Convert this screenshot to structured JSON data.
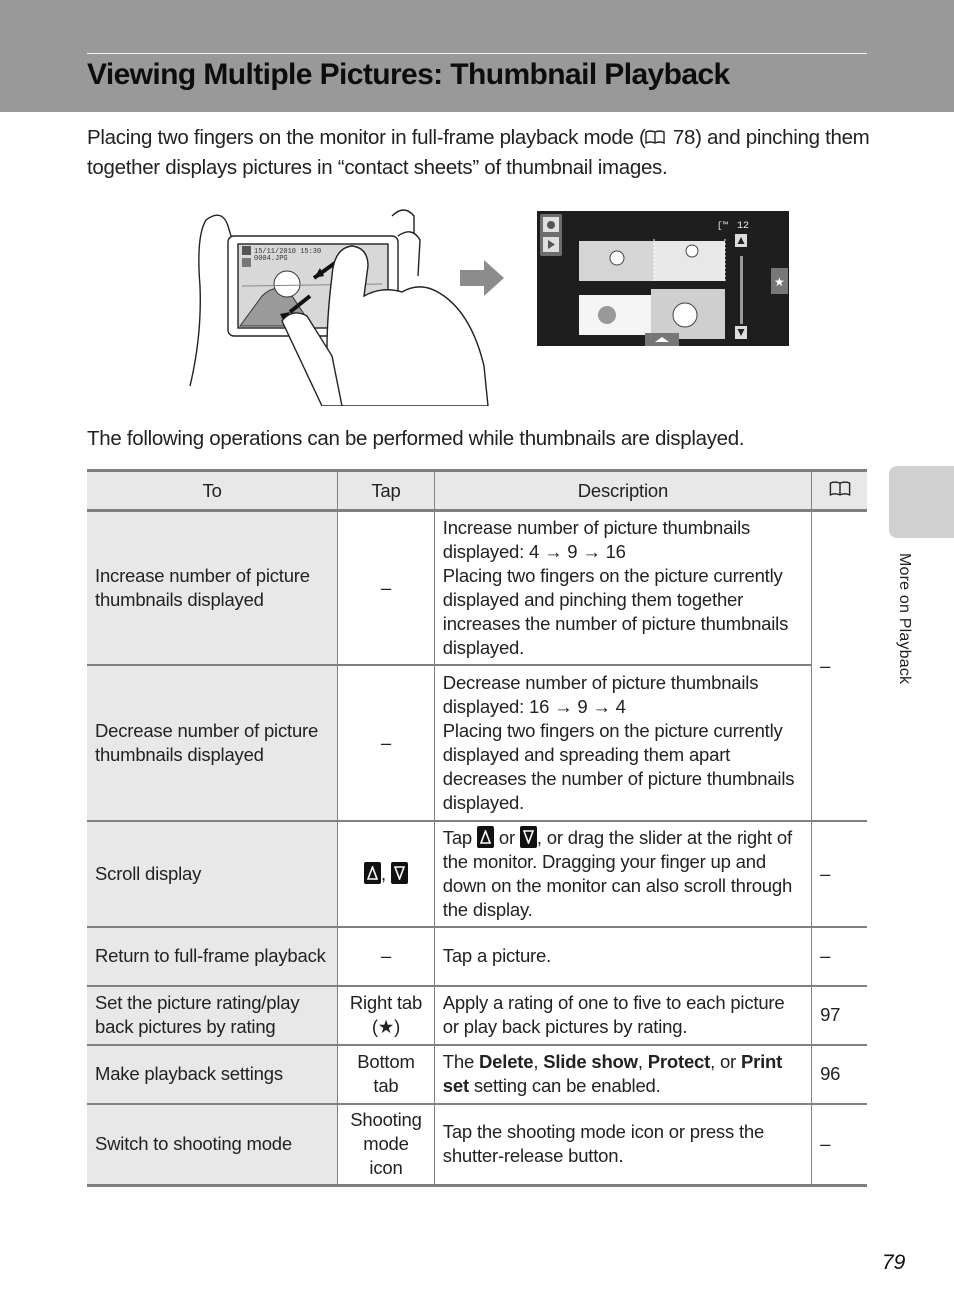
{
  "header": {
    "title": "Viewing Multiple Pictures: Thumbnail Playback",
    "band_color": "#999999"
  },
  "intro": {
    "text_before": "Placing two fingers on the monitor in full-frame playback mode (",
    "ref_icon": "book-icon",
    "ref_page": "78",
    "text_after": ") and pinching them together displays pictures in “contact sheets” of thumbnail images."
  },
  "illustration": {
    "left_screen_date": "15/11/2010 15:30",
    "left_screen_file": "0004.JPG",
    "right_screen_counter": "12",
    "right_tab_icon": "star-icon",
    "arrow_icon": "right-arrow-icon"
  },
  "ops_intro": "The following operations can be performed while thumbnails are displayed.",
  "table": {
    "headers": {
      "to": "To",
      "tap": "Tap",
      "description": "Description",
      "ref_icon": "book-icon"
    },
    "rows": [
      {
        "to": "Increase number of picture thumbnails displayed",
        "tap": "–",
        "desc_lines": [
          "Increase number of picture thumbnails displayed: 4 → 9 → 16",
          "Placing two fingers on the picture currently displayed and pinching them together increases the number of picture thumbnails displayed."
        ],
        "ref": "–"
      },
      {
        "to": "Decrease number of picture thumbnails displayed",
        "tap": "–",
        "desc_lines": [
          "Decrease number of picture thumbnails displayed: 16 → 9 → 4",
          "Placing two fingers on the picture currently displayed and spreading them apart decreases the number of picture thumbnails displayed."
        ],
        "ref": ""
      },
      {
        "to": "Scroll display",
        "tap_icons": [
          "scroll-up-icon",
          "scroll-down-icon"
        ],
        "tap_sep": ",",
        "desc_parts": [
          "Tap ",
          " or ",
          ", or drag the slider at the right of the monitor. Dragging your finger up and down on the monitor can also scroll through the display."
        ],
        "ref": "–"
      },
      {
        "to": "Return to full-frame playback",
        "tap": "–",
        "desc": "Tap a picture.",
        "ref": "–"
      },
      {
        "to": "Set the picture rating/play back pictures by rating",
        "tap": "Right tab (★)",
        "desc": "Apply a rating of one to five to each picture or play back pictures by rating.",
        "ref": "97"
      },
      {
        "to": "Make playback settings",
        "tap": "Bottom tab",
        "desc_parts": [
          "The ",
          "Delete",
          ", ",
          "Slide show",
          ", ",
          "Protect",
          ", or ",
          "Print set",
          " setting can be enabled."
        ],
        "ref": "96"
      },
      {
        "to": "Switch to shooting mode",
        "tap": "Shooting mode icon",
        "desc": "Tap the shooting mode icon or press the shutter-release button.",
        "ref": "–"
      }
    ]
  },
  "side_tab": {
    "label": "More on Playback"
  },
  "page_number": "79"
}
